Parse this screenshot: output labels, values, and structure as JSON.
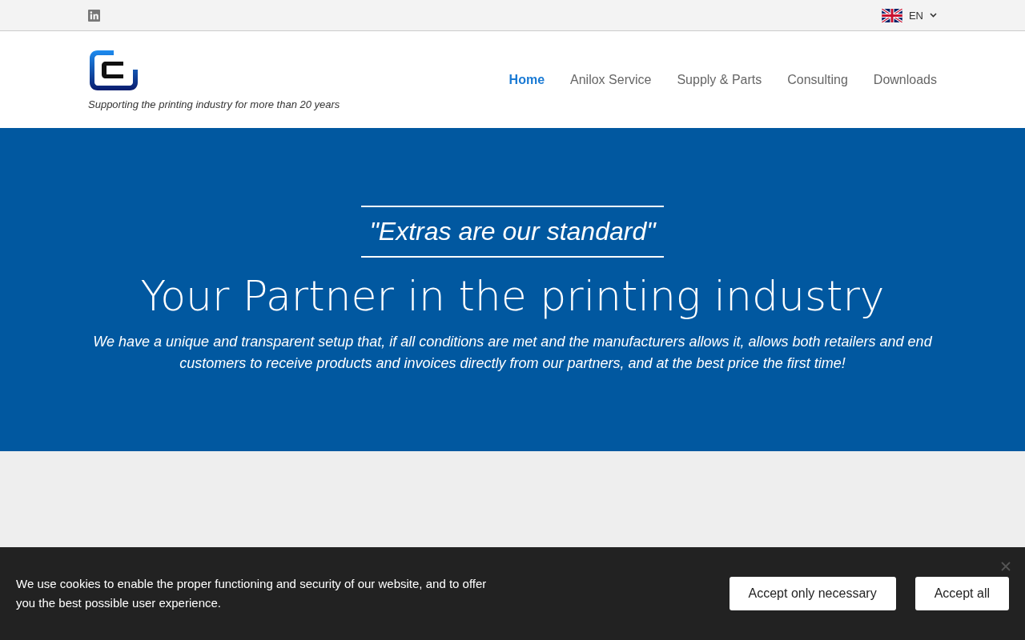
{
  "topbar": {
    "language": "EN"
  },
  "header": {
    "tagline": "Supporting the printing industry for more than 20 years",
    "nav": [
      {
        "label": "Home",
        "selected": true
      },
      {
        "label": "Anilox Service",
        "selected": false
      },
      {
        "label": "Supply & Parts",
        "selected": false
      },
      {
        "label": "Consulting",
        "selected": false
      },
      {
        "label": "Downloads",
        "selected": false
      }
    ]
  },
  "hero": {
    "quote": "\"Extras are our standard\"",
    "title": "Your Partner in the printing industry",
    "text": "We have a unique and transparent setup that, if all conditions are met and the manufacturers allows it, allows both retailers and end customers to receive products and invoices directly from our partners, and at the best price the first time!"
  },
  "cookie_bar": {
    "text": "We use cookies to enable the proper functioning and security of our website, and to offer you the best possible user experience.",
    "buttons": [
      "Accept only necessary",
      "Accept all"
    ]
  }
}
